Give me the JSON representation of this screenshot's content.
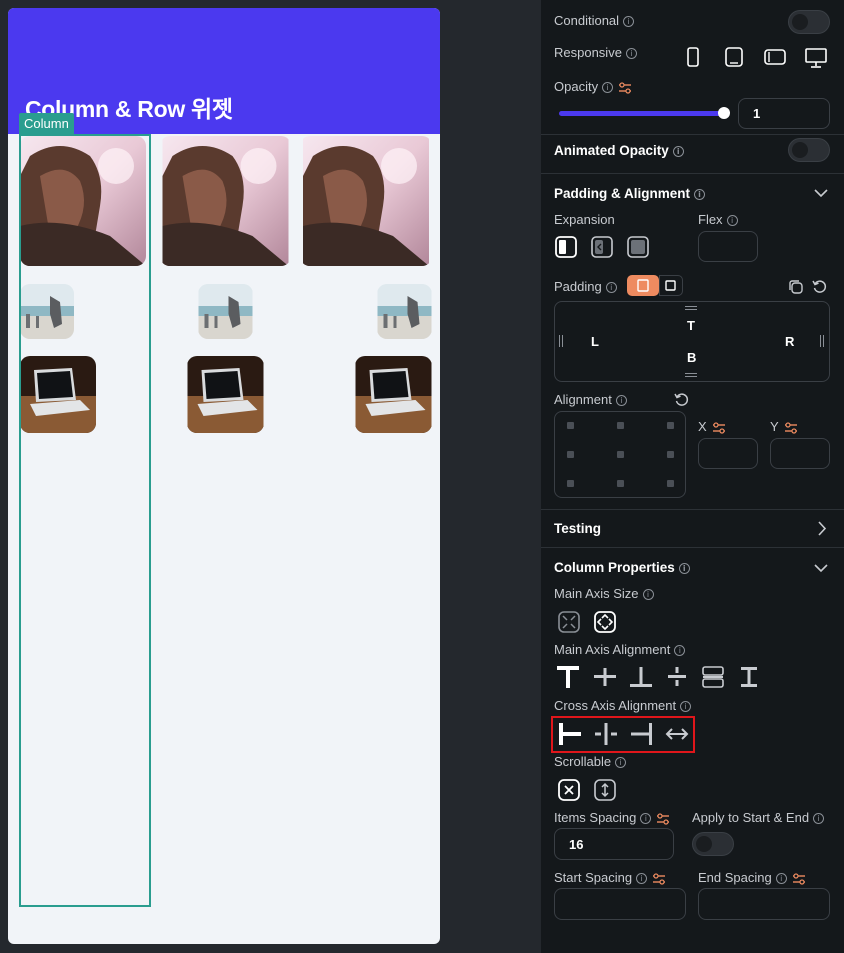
{
  "canvas": {
    "appbar_title": "Column & Row 위젯",
    "column_tag": "Column"
  },
  "panel": {
    "conditional_label": "Conditional",
    "responsive_label": "Responsive",
    "responsive_devices": [
      "phone-icon",
      "tablet-icon",
      "tablet-landscape-icon",
      "desktop-icon"
    ],
    "opacity_label": "Opacity",
    "opacity_value": "1",
    "opacity_fraction": 1,
    "animated_opacity_label": "Animated Opacity",
    "padding_alignment_header": "Padding & Alignment",
    "expansion_label": "Expansion",
    "flex_label": "Flex",
    "padding_label": "Padding",
    "padding_t": "T",
    "padding_b": "B",
    "padding_l": "L",
    "padding_r": "R",
    "alignment_label": "Alignment",
    "x_label": "X",
    "y_label": "Y",
    "testing_header": "Testing",
    "column_properties_header": "Column Properties",
    "main_axis_size_label": "Main Axis Size",
    "main_axis_alignment_label": "Main Axis Alignment",
    "cross_axis_alignment_label": "Cross Axis Alignment",
    "scrollable_label": "Scrollable",
    "items_spacing_label": "Items Spacing",
    "items_spacing_value": "16",
    "apply_start_end_label": "Apply to Start & End",
    "start_spacing_label": "Start Spacing",
    "end_spacing_label": "End Spacing",
    "accent_color": "#4b39ef",
    "highlight_color": "#e0161b",
    "padding_toggle_color": "#ee8b60"
  }
}
